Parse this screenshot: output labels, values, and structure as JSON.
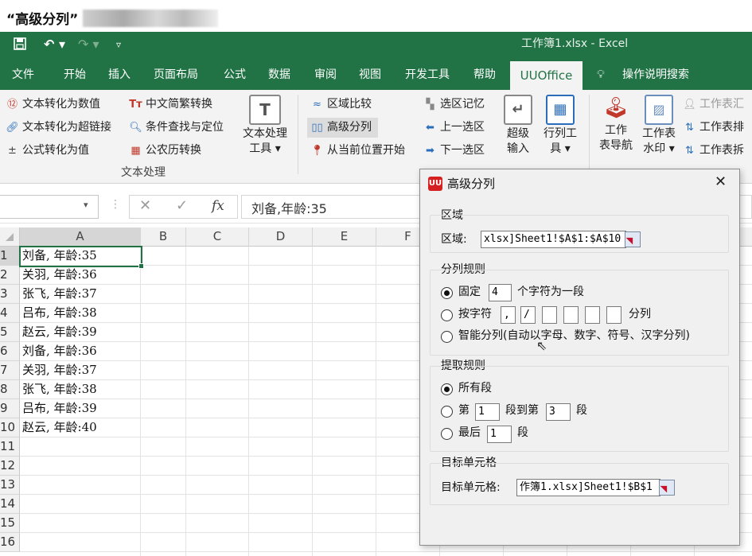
{
  "caption": {
    "title": "“高级分列”"
  },
  "window": {
    "title": "工作簿1.xlsx  -  Excel"
  },
  "quick_access": {
    "save_icon": "save-icon",
    "undo_icon": "undo-icon",
    "redo_icon": "redo-icon",
    "customize_icon": "customize-icon"
  },
  "tabs": [
    "文件",
    "开始",
    "插入",
    "页面布局",
    "公式",
    "数据",
    "审阅",
    "视图",
    "开发工具",
    "帮助",
    "UUOffice"
  ],
  "tell_me": "操作说明搜索",
  "ribbon": {
    "col1": [
      "文本转化为数值",
      "文本转化为超链接",
      "公式转化为值"
    ],
    "col2": [
      "中文简繁转换",
      "条件查找与定位",
      "公农历转换"
    ],
    "text_tool": [
      "文本处理",
      "工具"
    ],
    "group_label": "文本处理",
    "col3": [
      "区域比较",
      "高级分列",
      "从当前位置开始"
    ],
    "col4": [
      "选区记忆",
      "上一选区",
      "下一选区"
    ],
    "super_input": [
      "超级",
      "输入"
    ],
    "row_col_tool": [
      "行列工",
      "具"
    ],
    "sheet_nav": [
      "工作",
      "表导航"
    ],
    "watermark": [
      "工作表",
      "水印"
    ],
    "col5": [
      "工作表汇",
      "工作表排",
      "工作表拆"
    ]
  },
  "formula_bar": {
    "fx": "fx",
    "content": "刘备,年龄:35"
  },
  "grid": {
    "columns": [
      "A",
      "B",
      "C",
      "D",
      "E",
      "F"
    ],
    "rows": [
      "1",
      "2",
      "3",
      "4",
      "5",
      "6",
      "7",
      "8",
      "9",
      "10",
      "11",
      "12",
      "13",
      "14",
      "15",
      "16"
    ],
    "cells_a": [
      "刘备, 年龄:35",
      "关羽, 年龄:36",
      "张飞, 年龄:37",
      "吕布, 年龄:38",
      "赵云, 年龄:39",
      "刘备, 年龄:36",
      "关羽, 年龄:37",
      "张飞, 年龄:38",
      "吕布, 年龄:39",
      "赵云, 年龄:40"
    ]
  },
  "dialog": {
    "logo": "UU",
    "title": "高级分列",
    "region": {
      "group": "区域",
      "label": "区域:",
      "value": "xlsx]Sheet1!$A$1:$A$10"
    },
    "split_rule": {
      "group": "分列规则",
      "fixed_label": "固定",
      "fixed_value": "4",
      "fixed_suffix": "个字符为一段",
      "by_char_label": "按字符",
      "chars": [
        ",",
        "/",
        "",
        "",
        "",
        ""
      ],
      "by_char_suffix": "分列",
      "smart_label": "智能分列(自动以字母、数字、符号、汉字分列)",
      "selected": "fixed"
    },
    "extract_rule": {
      "group": "提取规则",
      "all_label": "所有段",
      "nth_label": "第",
      "nth_from": "1",
      "nth_mid": "段到第",
      "nth_to": "3",
      "nth_suffix": "段",
      "last_label": "最后",
      "last_value": "1",
      "last_suffix": "段",
      "selected": "all"
    },
    "target": {
      "group": "目标单元格",
      "label": "目标单元格:",
      "value": "作簿1.xlsx]Sheet1!$B$1"
    }
  }
}
